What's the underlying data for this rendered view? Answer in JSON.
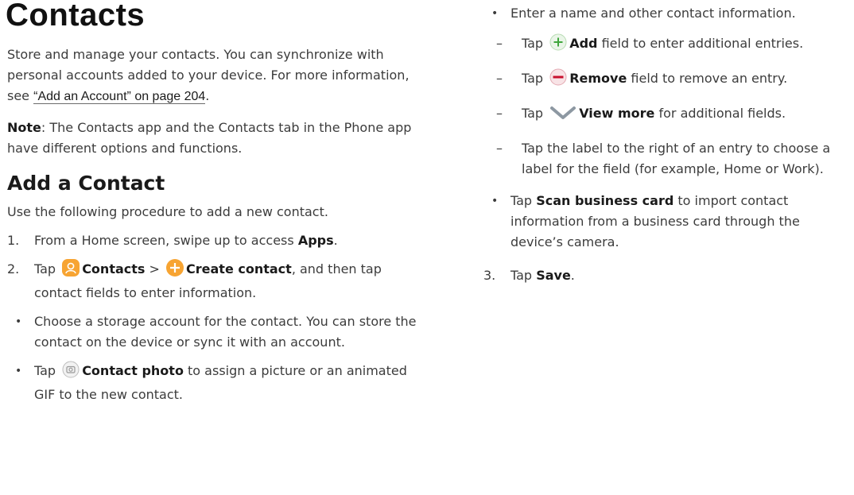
{
  "page": {
    "title": "Contacts",
    "intro": "Store and manage your contacts. You can synchronize with personal accounts added to your device. For more information, see",
    "intro_link": "“Add an Account” on page 204",
    "intro_end": ".",
    "note_label": "Note",
    "note_text": ": The Contacts app and the Contacts tab in the Phone app have different options and functions."
  },
  "section": {
    "heading": "Add a Contact",
    "intro": "Use the following procedure to add a new contact."
  },
  "steps": {
    "s1_num": "1.",
    "s1_pre": "From a Home screen, swipe up to access",
    "s1_bold": "Apps",
    "s1_end": ".",
    "s2_num": "2.",
    "s2_tap": "Tap",
    "s2_contacts": "Contacts",
    "s2_sep": ">",
    "s2_create": "Create contact",
    "s2_rest": ", and then tap contact fields to enter information.",
    "b1": "Choose a storage account for the contact. You can store the contact on the device or sync it with an account.",
    "b2_tap": "Tap",
    "b2_bold": "Contact photo",
    "b2_rest": "to assign a picture or an animated GIF to the new contact.",
    "b3": "Enter a name and other contact information.",
    "d1_tap": "Tap",
    "d1_bold": "Add",
    "d1_rest": "field to enter additional entries.",
    "d2_tap": "Tap",
    "d2_bold": "Remove",
    "d2_rest": "field to remove an entry.",
    "d3_tap": "Tap",
    "d3_bold": "View more",
    "d3_rest": "for additional fields.",
    "d4": "Tap the label to the right of an entry to choose a label for the field (for example, Home or Work).",
    "b4_tap": "Tap",
    "b4_bold": "Scan business card",
    "b4_rest": "to import contact information from a business card through the device’s camera.",
    "s3_num": "3.",
    "s3_tap": "Tap",
    "s3_bold": "Save",
    "s3_end": "."
  },
  "symbols": {
    "bullet": "•",
    "dash": "–"
  },
  "icons": {
    "contacts": "contacts-app-icon",
    "create": "create-contact-plus-icon",
    "photo": "camera-icon",
    "add": "add-field-plus-icon",
    "remove": "remove-field-minus-icon",
    "more": "chevron-down-icon"
  },
  "colors": {
    "orange": "#f7a432",
    "green": "#3fa63c",
    "red": "#c8102e"
  }
}
